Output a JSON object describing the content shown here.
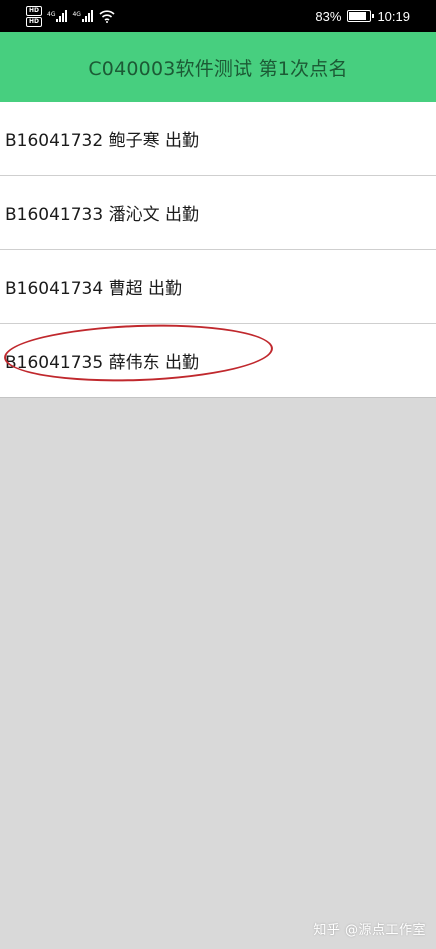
{
  "status_bar": {
    "hd_badges": [
      "HD",
      "HD"
    ],
    "network_types": [
      "4G",
      "4G"
    ],
    "battery_percent": "83%",
    "battery_level": 0.83,
    "time": "10:19"
  },
  "header": {
    "title": "C040003软件测试 第1次点名"
  },
  "attendance_list": [
    {
      "label": "B16041732 鲍子寒 出勤"
    },
    {
      "label": "B16041733 潘沁文 出勤"
    },
    {
      "label": "B16041734 曹超 出勤"
    },
    {
      "label": "B16041735 薛伟东 出勤"
    }
  ],
  "watermark": "知乎 @源点工作室",
  "colors": {
    "title_bar": "#47cf7f",
    "title_text": "#1c5a35",
    "annotation": "#c0282d",
    "background": "#d9d9d9"
  }
}
